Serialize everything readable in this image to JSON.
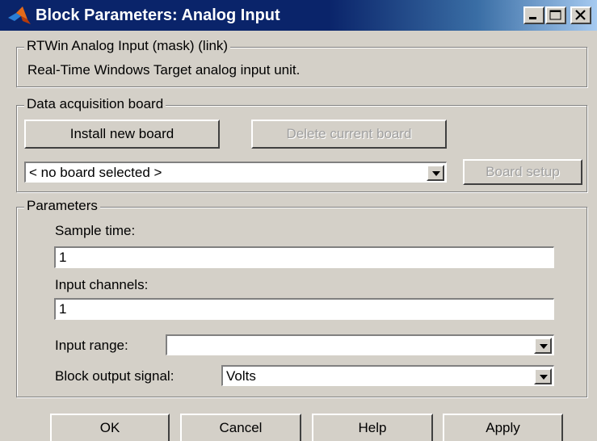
{
  "window": {
    "title": "Block Parameters: Analog Input"
  },
  "mask": {
    "legend": "RTWin Analog Input (mask) (link)",
    "description": "Real-Time Windows Target analog input unit."
  },
  "daq": {
    "legend": "Data acquisition board",
    "install_label": "Install new board",
    "delete_label": "Delete current board",
    "board_selected": "< no board selected >",
    "board_setup_label": "Board setup"
  },
  "params": {
    "legend": "Parameters",
    "sample_time_label": "Sample time:",
    "sample_time_value": "1",
    "input_channels_label": "Input channels:",
    "input_channels_value": "1",
    "input_range_label": "Input range:",
    "input_range_value": "",
    "output_signal_label": "Block output signal:",
    "output_signal_value": "Volts"
  },
  "buttons": {
    "ok": "OK",
    "cancel": "Cancel",
    "help": "Help",
    "apply": "Apply"
  },
  "icons": {
    "app": "matlab-icon",
    "minimize": "minimize-icon",
    "maximize": "maximize-icon",
    "close": "close-icon",
    "dropdown": "chevron-down-icon"
  }
}
